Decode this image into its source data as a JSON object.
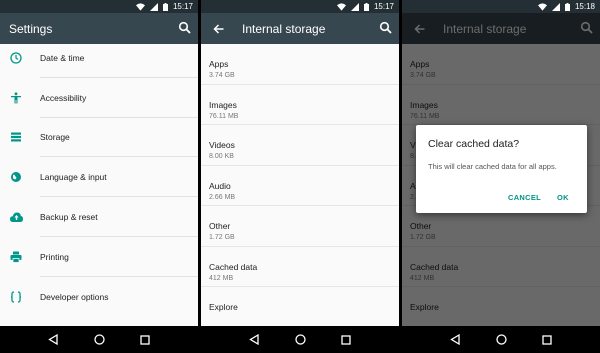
{
  "status": {
    "time1": "15:17",
    "time2": "15:17",
    "time3": "15:18"
  },
  "settings": {
    "title": "Settings",
    "items": [
      {
        "label": "Date & time",
        "icon": "clock-icon"
      },
      {
        "label": "Accessibility",
        "icon": "accessibility-icon"
      },
      {
        "label": "Storage",
        "icon": "storage-icon"
      },
      {
        "label": "Language & input",
        "icon": "globe-icon"
      },
      {
        "label": "Backup & reset",
        "icon": "cloud-upload-icon"
      },
      {
        "label": "Printing",
        "icon": "printer-icon"
      },
      {
        "label": "Developer options",
        "icon": "code-braces-icon"
      }
    ]
  },
  "storage": {
    "title": "Internal storage",
    "items": [
      {
        "label": "Apps",
        "size": "3.74 GB"
      },
      {
        "label": "Images",
        "size": "76.11 MB"
      },
      {
        "label": "Videos",
        "size": "8.00 KB"
      },
      {
        "label": "Audio",
        "size": "2.66 MB"
      },
      {
        "label": "Other",
        "size": "1.72 GB"
      },
      {
        "label": "Cached data",
        "size": "412 MB"
      },
      {
        "label": "Explore",
        "size": ""
      }
    ]
  },
  "dialog": {
    "title": "Clear cached data?",
    "body": "This will clear cached data for all apps.",
    "cancel": "CANCEL",
    "ok": "OK"
  },
  "colors": {
    "appbar": "#37474f",
    "statusbar": "#232f34",
    "accent": "#009688",
    "icons": "#009688"
  }
}
